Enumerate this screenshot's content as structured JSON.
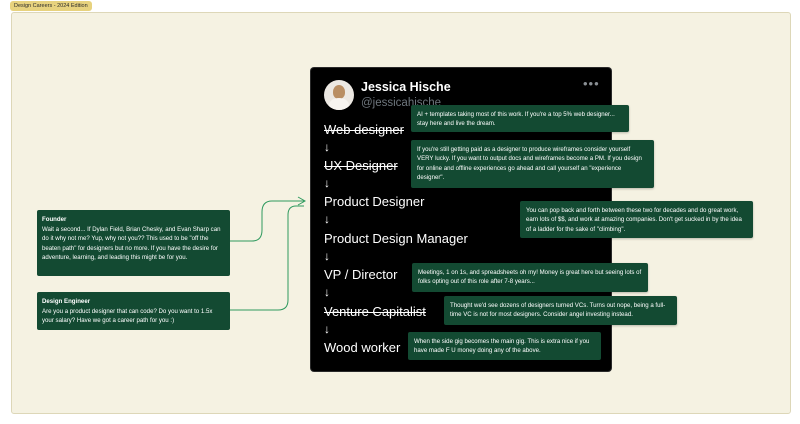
{
  "badge": "Design Careers - 2024 Edition",
  "tweet": {
    "author_name": "Jessica Hische",
    "author_handle": "@jessicahische",
    "more_glyph": "•••",
    "roles": [
      {
        "label": "Web designer",
        "struck": true
      },
      {
        "label": "UX Designer",
        "struck": true
      },
      {
        "label": "Product Designer",
        "struck": false
      },
      {
        "label": "Product Design Manager",
        "struck": false
      },
      {
        "label": "VP / Director",
        "struck": false
      },
      {
        "label": "Venture Capitalist",
        "struck": true
      },
      {
        "label": "Wood worker",
        "struck": false
      }
    ],
    "arrow": "↓"
  },
  "annotations": {
    "web": "AI + templates taking most of this work. If you're a top 5% web designer... stay here and live the dream.",
    "ux": "If you're still getting paid as a designer to produce wireframes consider yourself VERY lucky. If you want to output docs and wireframes  become a PM. If you design for online and offline experiences go ahead and call yourself an \"experience designer\".",
    "product": "You can pop back and forth between these two for decades and do great work, earn lots of $$, and work at amazing companies. Don't get sucked in by the idea of a ladder for the sake of \"climbing\".",
    "vp": "Meetings, 1 on 1s, and spreadsheets oh my! Money is great here but seeing lots of folks opting out of this role after 7-8 years...",
    "vc": "Thought we'd see dozens of designers turned VCs. Turns out nope, being a full-time VC is not for most designers. Consider angel investing instead.",
    "wood": "When the side gig becomes the main gig. This is extra nice if you have made F U money doing any of the above."
  },
  "side_notes": {
    "founder": {
      "title": "Founder",
      "body": "Wait a second... If Dylan Field, Brian Chesky, and Evan Sharp can do it why not me? Yup, why not you?? This used to be \"off the beaten path\" for designers but no more. If you have the desire for adventure, learning, and leading this might be for you."
    },
    "engineer": {
      "title": "Design Engineer",
      "body": "Are you a product designer that can code? Do you want to 1.5x your salary? Have we got a career path for you :)"
    }
  },
  "colors": {
    "note_bg": "#134a32",
    "connector": "#2f9a5f",
    "canvas": "#f5f2e2",
    "badge": "#e7d27e"
  }
}
